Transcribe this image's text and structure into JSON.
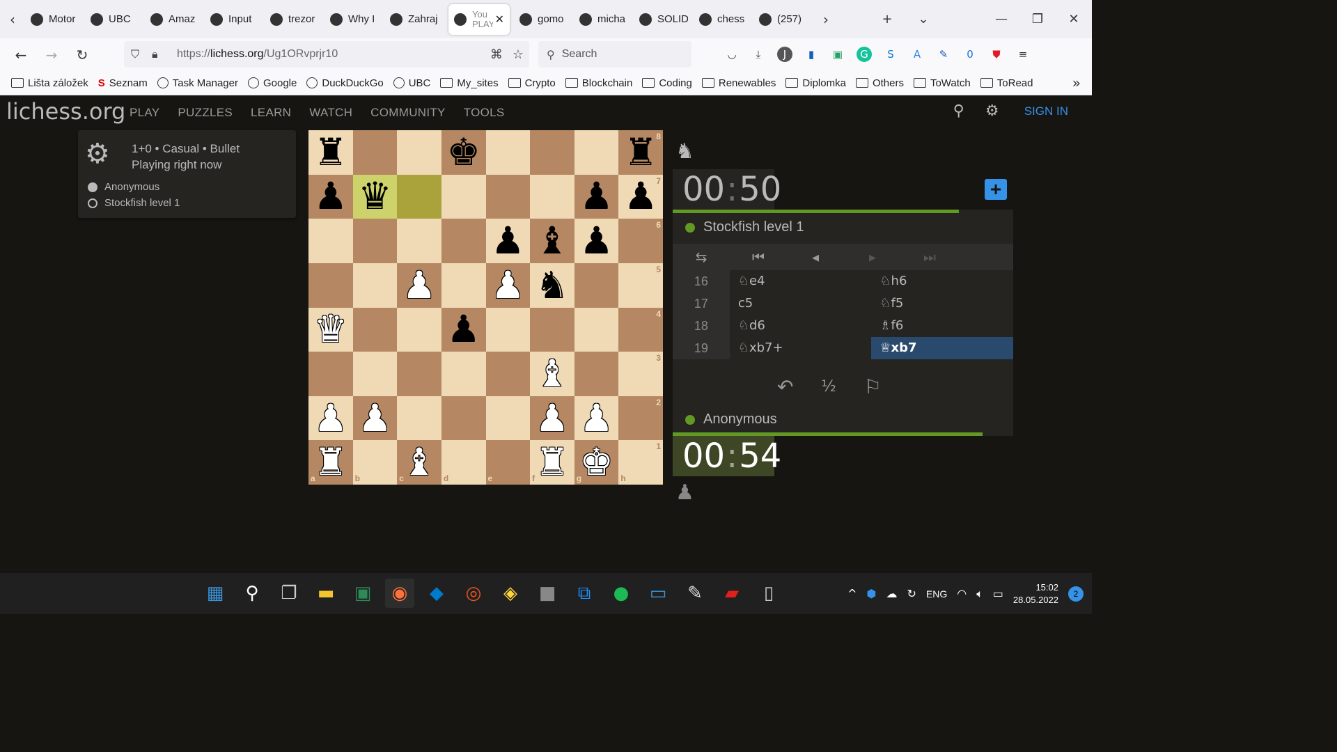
{
  "tabs": [
    {
      "label": "Motor",
      "icon": "page-icon"
    },
    {
      "label": "UBC",
      "icon": "page-icon"
    },
    {
      "label": "Amaz",
      "icon": "amazon-icon"
    },
    {
      "label": "Input",
      "icon": "error-icon"
    },
    {
      "label": "trezor",
      "icon": "github-icon"
    },
    {
      "label": "Why I",
      "icon": "page-icon"
    },
    {
      "label": "Zahraj",
      "icon": "pawn-icon"
    },
    {
      "label": "You",
      "sublabel": "PLAY",
      "icon": "lichess-icon",
      "active": true
    },
    {
      "label": "gomo",
      "icon": "github-icon"
    },
    {
      "label": "micha",
      "icon": "github-icon"
    },
    {
      "label": "SOLID",
      "icon": "page-icon"
    },
    {
      "label": "chess",
      "icon": "page-icon"
    },
    {
      "label": "(257)",
      "icon": "page-icon"
    }
  ],
  "nav": {
    "url_prefix": "https://",
    "url_domain": "lichess.org",
    "url_path": "/Ug1ORvprjr10",
    "search_placeholder": "Search"
  },
  "extensions": [
    {
      "icon": "pocket-icon",
      "text": "",
      "color": "#333"
    },
    {
      "icon": "download-icon",
      "text": "",
      "color": "#333"
    },
    {
      "icon": "profile-icon",
      "text": "J",
      "color": "#555"
    },
    {
      "icon": "bars-icon",
      "text": "",
      "color": "#1a5fb4"
    },
    {
      "icon": "save-icon",
      "text": "",
      "color": "#26a269"
    },
    {
      "icon": "grammarly-icon",
      "text": "G",
      "color": "#15c39a"
    },
    {
      "icon": "skype-icon",
      "text": "S",
      "color": "#0078d4"
    },
    {
      "icon": "translate-icon",
      "text": "A",
      "color": "#3584e4"
    },
    {
      "icon": "brush-icon",
      "text": "",
      "color": "#1a5fb4"
    },
    {
      "icon": "badge-icon",
      "text": "0",
      "color": "#1c71d8"
    },
    {
      "icon": "shield-icon",
      "text": "",
      "color": "#e01b24"
    },
    {
      "icon": "menu-icon",
      "text": "",
      "color": "#333"
    }
  ],
  "bookmarks": [
    {
      "label": "Lišta záložek",
      "kind": "folder"
    },
    {
      "label": "Seznam",
      "kind": "red"
    },
    {
      "label": "Task Manager",
      "kind": "globe"
    },
    {
      "label": "Google",
      "kind": "globe"
    },
    {
      "label": "DuckDuckGo",
      "kind": "globe"
    },
    {
      "label": "UBC",
      "kind": "globe"
    },
    {
      "label": "My_sites",
      "kind": "folder"
    },
    {
      "label": "Crypto",
      "kind": "folder"
    },
    {
      "label": "Blockchain",
      "kind": "folder"
    },
    {
      "label": "Coding",
      "kind": "folder"
    },
    {
      "label": "Renewables",
      "kind": "folder"
    },
    {
      "label": "Diplomka",
      "kind": "folder"
    },
    {
      "label": "Others",
      "kind": "folder"
    },
    {
      "label": "ToWatch",
      "kind": "folder"
    },
    {
      "label": "ToRead",
      "kind": "folder"
    }
  ],
  "site": {
    "logo": "lichess.org",
    "menu": [
      "PLAY",
      "PUZZLES",
      "LEARN",
      "WATCH",
      "COMMUNITY",
      "TOOLS"
    ],
    "sign_in": "SIGN IN"
  },
  "game": {
    "line1": "1+0 • Casual • Bullet",
    "line2": "Playing right now",
    "white_player": "Anonymous",
    "black_player": "Stockfish level 1"
  },
  "board": {
    "rows": [
      [
        "r",
        "",
        "",
        "k",
        "",
        "",
        "",
        "r"
      ],
      [
        "p",
        "q",
        "",
        "",
        "",
        "",
        "p",
        "p"
      ],
      [
        "",
        "",
        "",
        "",
        "p",
        "b",
        "p",
        ""
      ],
      [
        "",
        "",
        "P",
        "",
        "P",
        "n",
        "",
        ""
      ],
      [
        "Q",
        "",
        "",
        "p",
        "",
        "",
        "",
        ""
      ],
      [
        "",
        "",
        "",
        "",
        "",
        "B",
        "",
        ""
      ],
      [
        "P",
        "P",
        "",
        "",
        "",
        "P",
        "P",
        ""
      ],
      [
        "R",
        "",
        "B",
        "",
        "",
        "R",
        "K",
        ""
      ]
    ],
    "highlight": [
      [
        1,
        1
      ],
      [
        1,
        2
      ]
    ],
    "ranks": [
      "8",
      "7",
      "6",
      "5",
      "4",
      "3",
      "2",
      "1"
    ],
    "files": [
      "a",
      "b",
      "c",
      "d",
      "e",
      "f",
      "g",
      "h"
    ]
  },
  "clocks": {
    "top_min": "00",
    "top_sec": "50",
    "bottom_min": "00",
    "bottom_sec": "54",
    "top_fraction": 0.84,
    "bottom_fraction": 0.91
  },
  "panel": {
    "top_player": "Stockfish level 1",
    "bottom_player": "Anonymous",
    "moves": [
      {
        "n": "16",
        "w": "♘e4",
        "b": "♘h6"
      },
      {
        "n": "17",
        "w": "c5",
        "b": "♘f5"
      },
      {
        "n": "18",
        "w": "♘d6",
        "b": "♗f6"
      },
      {
        "n": "19",
        "w": "♘xb7+",
        "b": "♕xb7"
      }
    ],
    "draw_label": "½"
  },
  "taskbar": {
    "apps": [
      {
        "name": "start-icon",
        "color": "#3a96dd",
        "glyph": "▦"
      },
      {
        "name": "search-icon",
        "color": "#fff",
        "glyph": "⚲"
      },
      {
        "name": "task-view-icon",
        "color": "#ccc",
        "glyph": "❐"
      },
      {
        "name": "file-explorer-icon",
        "color": "#f4c430",
        "glyph": "▬"
      },
      {
        "name": "image-app-icon",
        "color": "#2e8b57",
        "glyph": "▣"
      },
      {
        "name": "firefox-icon",
        "color": "#ff7139",
        "glyph": "◉",
        "active": true
      },
      {
        "name": "vscode-icon",
        "color": "#007acc",
        "glyph": "◆"
      },
      {
        "name": "ubuntu-icon",
        "color": "#e95420",
        "glyph": "◎"
      },
      {
        "name": "python-icon",
        "color": "#ffd43b",
        "glyph": "◈"
      },
      {
        "name": "ctrl-icon",
        "color": "#888",
        "glyph": "■"
      },
      {
        "name": "remote-icon",
        "color": "#1e90ff",
        "glyph": "⧉"
      },
      {
        "name": "spotify-icon",
        "color": "#1db954",
        "glyph": "●"
      },
      {
        "name": "window-icon",
        "color": "#3a96dd",
        "glyph": "▭"
      },
      {
        "name": "paint-icon",
        "color": "#ddd",
        "glyph": "✎"
      },
      {
        "name": "acrobat-icon",
        "color": "#e0201b",
        "glyph": "▰"
      },
      {
        "name": "terminal-icon",
        "color": "#ccc",
        "glyph": "▯"
      }
    ],
    "language": "ENG",
    "time": "15:02",
    "date": "28.05.2022",
    "notifications": "2"
  }
}
